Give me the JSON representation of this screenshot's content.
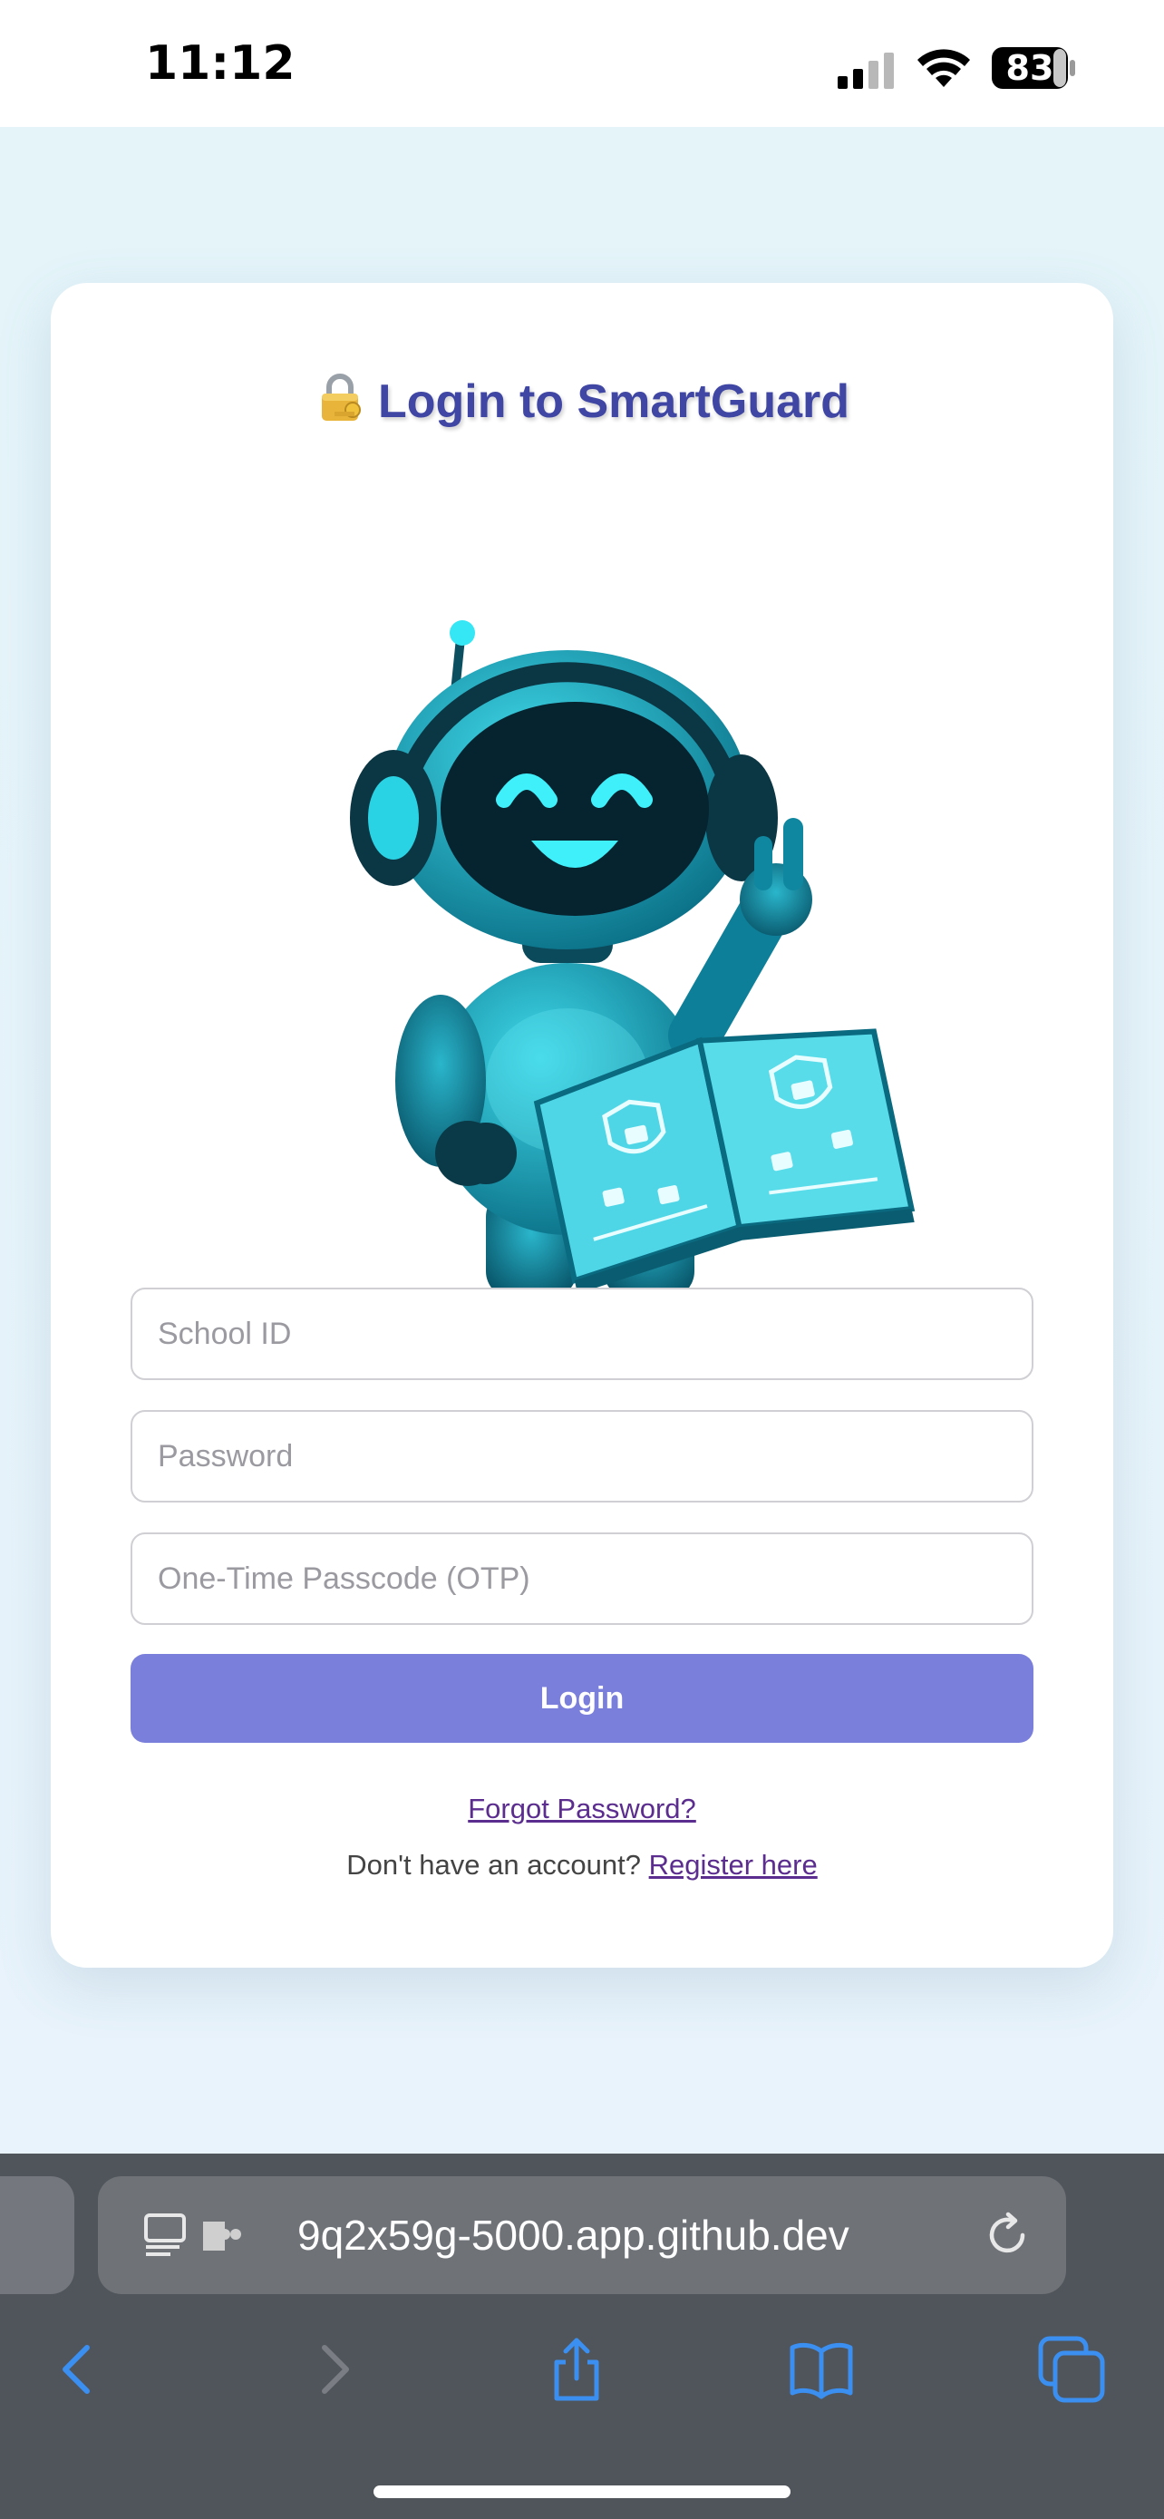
{
  "status_bar": {
    "time": "11:12",
    "battery": "83",
    "icons": [
      "signal-icon",
      "wifi-icon",
      "battery-icon"
    ]
  },
  "login_card": {
    "title": "Login to SmartGuard",
    "title_icon": "lock-with-key-icon",
    "title_color": "#3f46a3",
    "illustration": "robot-holding-security-book",
    "fields": {
      "school_id_placeholder": "School ID",
      "password_placeholder": "Password",
      "otp_placeholder": "One-Time Passcode (OTP)"
    },
    "login_button": "Login",
    "button_color": "#7b7fdc",
    "forgot_password": "Forgot Password?",
    "no_account_text": "Don't have an account?",
    "register_link": "Register here"
  },
  "browser": {
    "url": "9q2x59g-5000.app.github.dev",
    "icons": [
      "reader-icon",
      "extension-icon",
      "reload-icon",
      "back-icon",
      "forward-icon",
      "share-icon",
      "bookmarks-icon",
      "tabs-icon"
    ]
  }
}
